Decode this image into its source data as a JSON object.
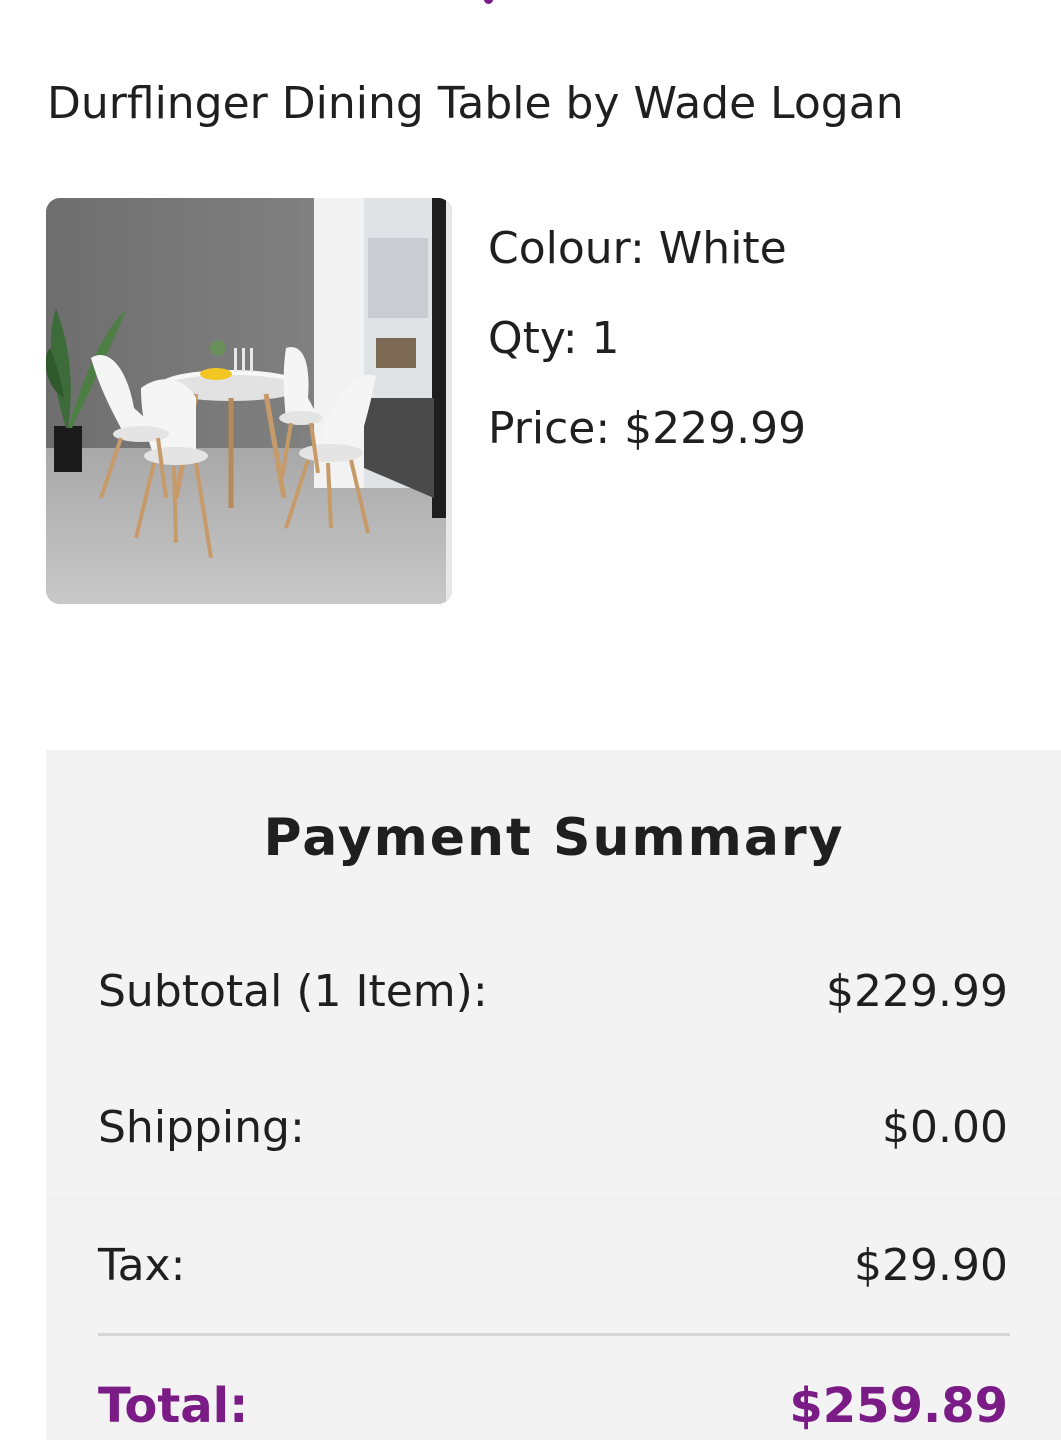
{
  "product": {
    "title": "Durflinger Dining Table by Wade Logan",
    "image_alt": "White round dining table with four white chairs",
    "colour": "Colour: White",
    "qty": "Qty: 1",
    "price": "Price: $229.99"
  },
  "summary": {
    "title": "Payment Summary",
    "rows": [
      {
        "label": "Subtotal (1 Item):",
        "value": "$229.99"
      },
      {
        "label": "Shipping:",
        "value": "$0.00"
      },
      {
        "label": "Tax:",
        "value": "$29.90"
      }
    ],
    "total": {
      "label": "Total:",
      "value": "$259.89"
    }
  },
  "colors": {
    "accent": "#7b1b86",
    "panel_background": "#f3f3f3",
    "text": "#1f1f1f"
  }
}
